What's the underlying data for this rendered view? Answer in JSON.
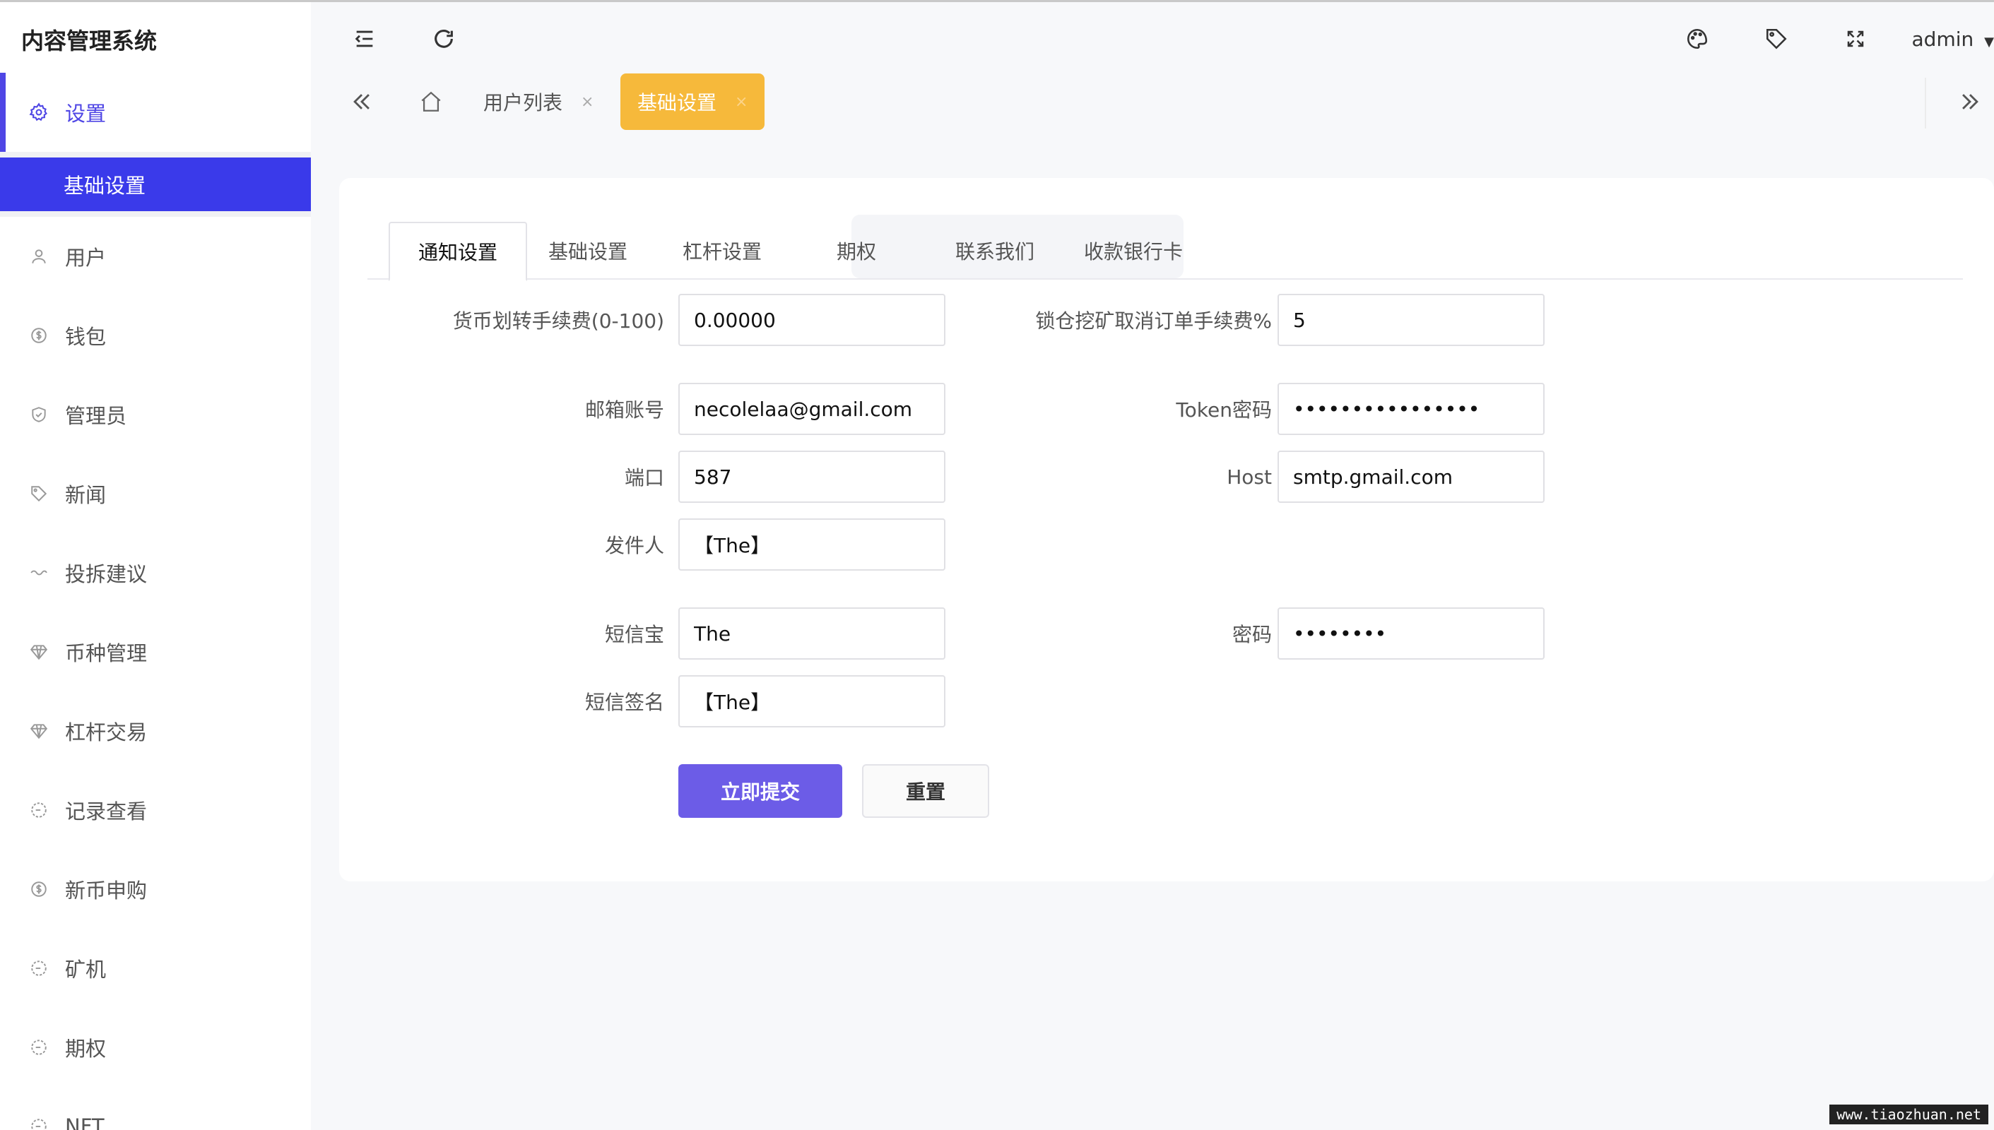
{
  "app": {
    "title": "内容管理系统"
  },
  "header": {
    "user": "admin"
  },
  "sidebar": {
    "items": [
      {
        "label": "设置",
        "icon": "gear-icon"
      },
      {
        "label": "用户",
        "icon": "user-icon"
      },
      {
        "label": "钱包",
        "icon": "dollar-icon"
      },
      {
        "label": "管理员",
        "icon": "shield-icon"
      },
      {
        "label": "新闻",
        "icon": "tag-icon"
      },
      {
        "label": "投拆建议",
        "icon": "link-icon"
      },
      {
        "label": "币种管理",
        "icon": "diamond-icon"
      },
      {
        "label": "杠杆交易",
        "icon": "diamond-icon"
      },
      {
        "label": "记录查看",
        "icon": "history-icon"
      },
      {
        "label": "新币申购",
        "icon": "dollar-icon"
      },
      {
        "label": "矿机",
        "icon": "history-icon"
      },
      {
        "label": "期权",
        "icon": "history-icon"
      },
      {
        "label": "NFT",
        "icon": "history-icon"
      }
    ],
    "submenu": {
      "label": "基础设置"
    }
  },
  "tabsbar": {
    "tabs": [
      {
        "label": "用户列表",
        "close": "×"
      },
      {
        "label": "基础设置",
        "close": "×"
      }
    ]
  },
  "form": {
    "tabs": [
      "通知设置",
      "基础设置",
      "杠杆设置",
      "期权",
      "联系我们",
      "收款银行卡"
    ],
    "fields": {
      "transfer_fee": {
        "label": "货币划转手续费(0-100)",
        "value": "0.00000"
      },
      "lock_fee": {
        "label": "锁仓挖矿取消订单手续费%",
        "value": "5"
      },
      "email": {
        "label": "邮箱账号",
        "value": "necolelaa@gmail.com"
      },
      "token_pwd": {
        "label": "Token密码",
        "value": "••••••••••••••••"
      },
      "port": {
        "label": "端口",
        "value": "587"
      },
      "host": {
        "label": "Host",
        "value": "smtp.gmail.com"
      },
      "sender": {
        "label": "发件人",
        "value": "【The】"
      },
      "sms": {
        "label": "短信宝",
        "value": "The"
      },
      "sms_pwd": {
        "label": "密码",
        "value": "••••••••"
      },
      "sms_sign": {
        "label": "短信签名",
        "value": "【The】"
      }
    },
    "submit_label": "立即提交",
    "reset_label": "重置"
  },
  "watermark": "www.tiaozhuan.net"
}
